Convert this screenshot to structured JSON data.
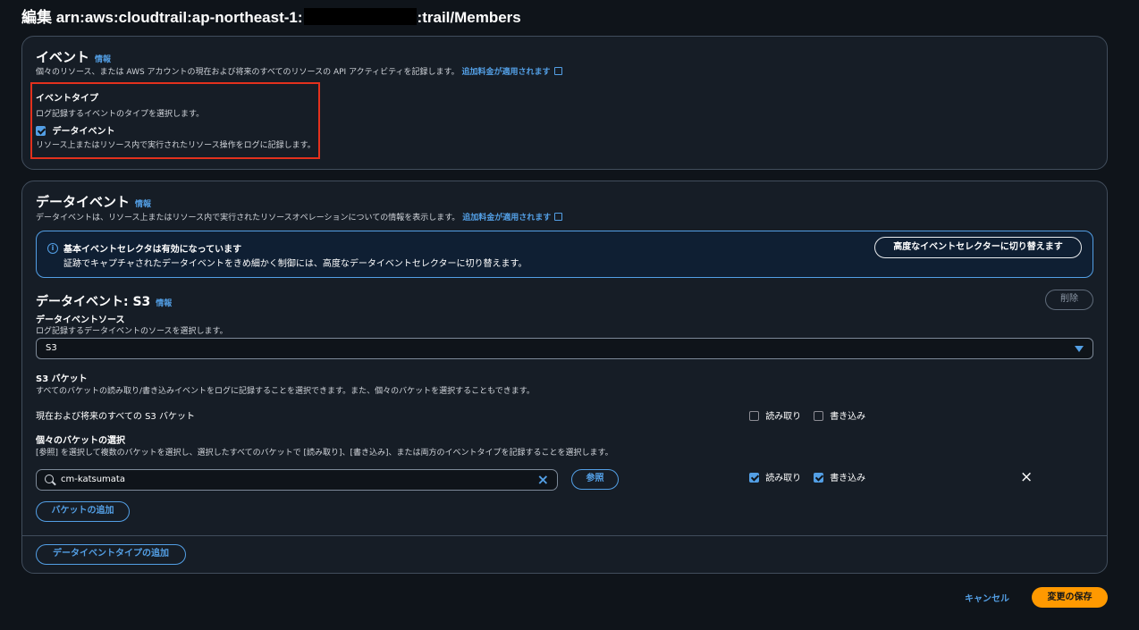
{
  "page": {
    "title_prefix": "編集 arn:aws:cloudtrail:ap-northeast-1:",
    "title_suffix": ":trail/Members"
  },
  "events_panel": {
    "heading": "イベント",
    "info": "情報",
    "description": "個々のリソース、または AWS アカウントの現在および将来のすべてのリソースの API アクティビティを記録します。",
    "pricing_link": "追加料金が適用されます",
    "event_type_label": "イベントタイプ",
    "event_type_desc": "ログ記録するイベントのタイプを選択します。",
    "data_event_checkbox": "データイベント",
    "data_event_checked": true,
    "data_event_desc": "リソース上またはリソース内で実行されたリソース操作をログに記録します。"
  },
  "data_events_panel": {
    "heading": "データイベント",
    "info": "情報",
    "description": "データイベントは、リソース上またはリソース内で実行されたリソースオペレーションについての情報を表示します。",
    "pricing_link": "追加料金が適用されます",
    "alert": {
      "title": "基本イベントセレクタは有効になっています",
      "body": "証跡でキャプチャされたデータイベントをきめ細かく制御には、高度なデータイベントセレクターに切り替えます。",
      "switch_button": "高度なイベントセレクターに切り替えます"
    },
    "s3_section": {
      "heading": "データイベント: S3",
      "info": "情報",
      "remove_button": "削除",
      "source_label": "データイベントソース",
      "source_desc": "ログ記録するデータイベントのソースを選択します。",
      "source_value": "S3",
      "bucket_label": "S3 バケット",
      "bucket_desc": "すべてのバケットの読み取り/書き込みイベントをログに記録することを選択できます。また、個々のバケットを選択することもできます。",
      "all_buckets_label": "現在および将来のすべての S3 バケット",
      "all_read_label": "読み取り",
      "all_read_checked": false,
      "all_write_label": "書き込み",
      "all_write_checked": false,
      "individual_label": "個々のバケットの選択",
      "individual_desc": "[参照] を選択して複数のバケットを選択し、選択したすべてのバケットで [読み取り]、[書き込み]、または両方のイベントタイプを記録することを選択します。",
      "bucket_input_value": "cm-katsumata",
      "browse_button": "参照",
      "row_read_label": "読み取り",
      "row_read_checked": true,
      "row_write_label": "書き込み",
      "row_write_checked": true,
      "add_bucket_button": "バケットの追加"
    },
    "add_type_button": "データイベントタイプの追加"
  },
  "footer": {
    "cancel": "キャンセル",
    "save": "変更の保存"
  },
  "colors": {
    "background": "#0f141a",
    "panel": "#161d26",
    "link": "#539fe5",
    "primary": "#ff9900",
    "highlight": "#e3311d"
  }
}
